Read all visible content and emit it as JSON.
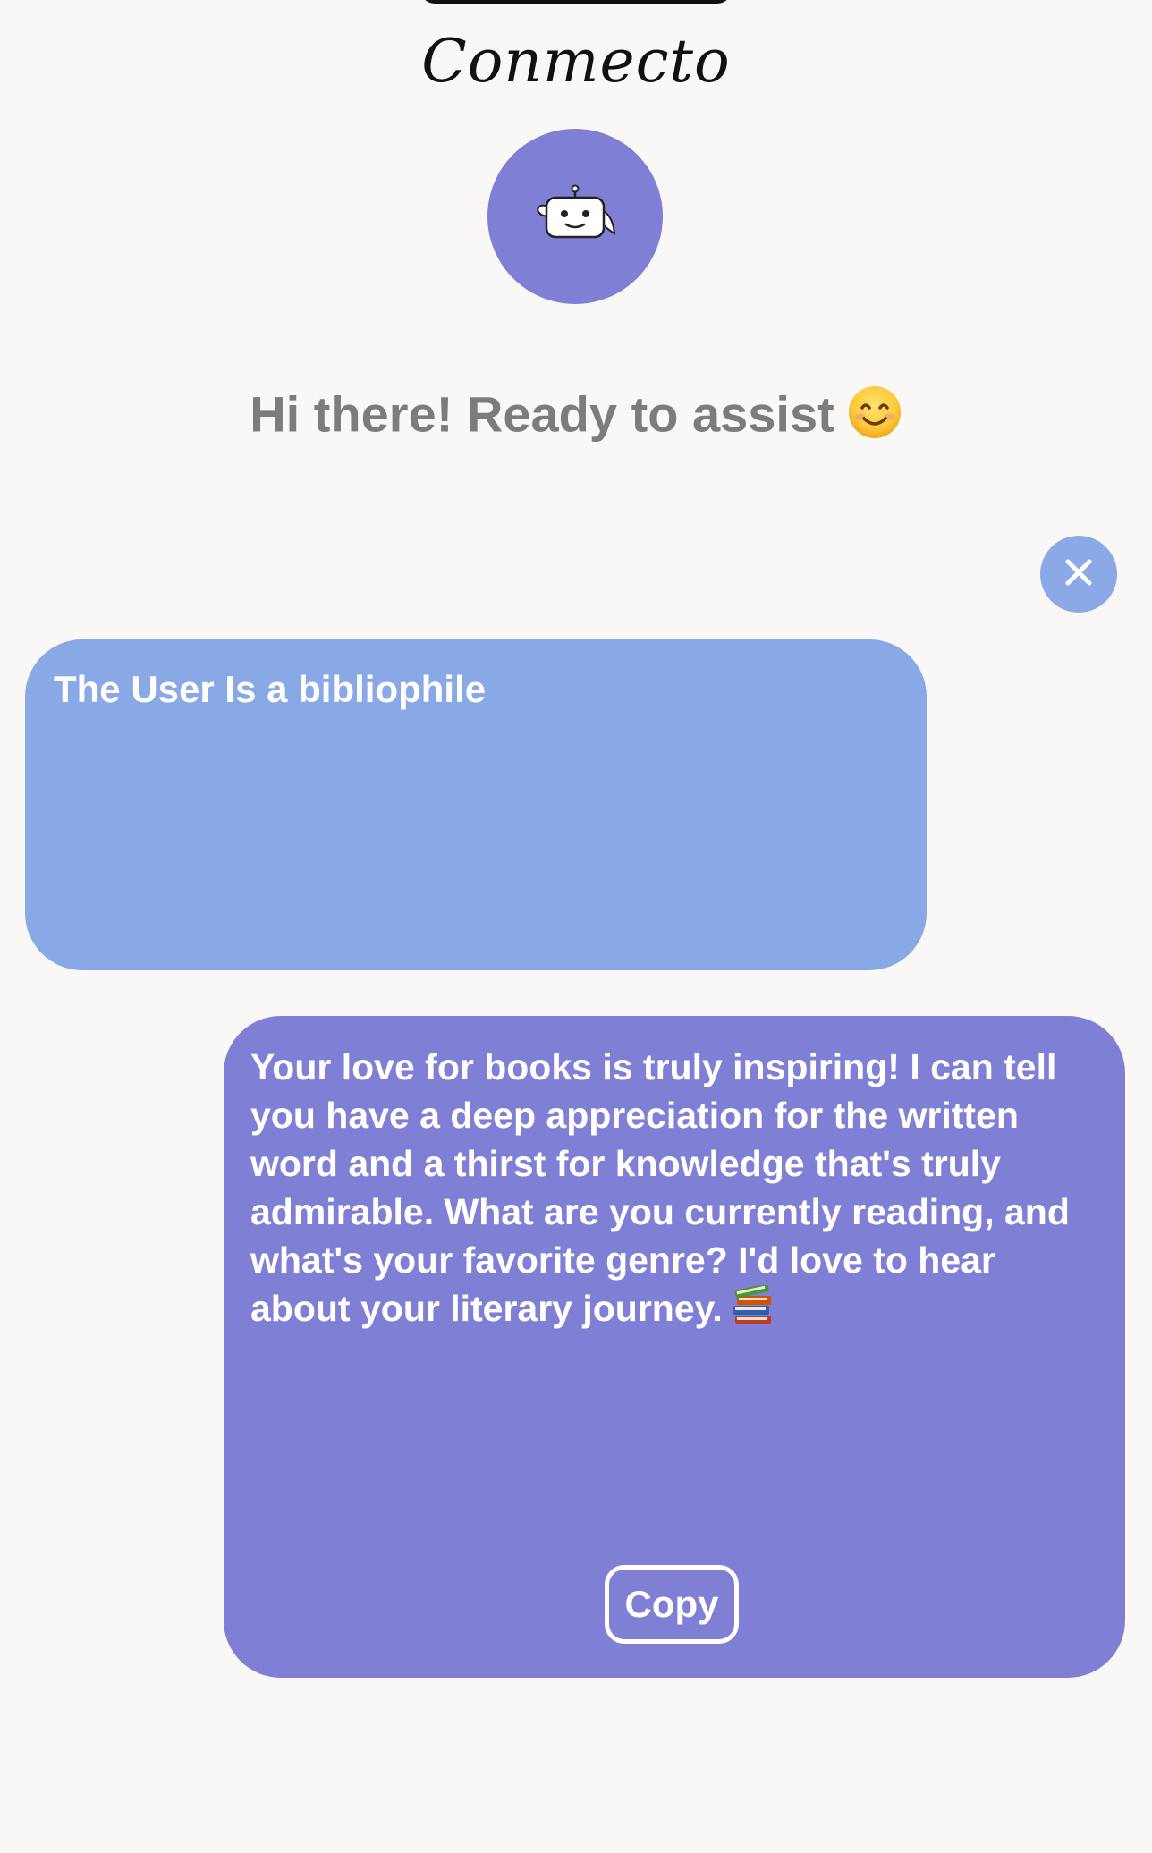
{
  "app": {
    "title": "Conmecto"
  },
  "header": {
    "greeting": "Hi there! Ready to assist",
    "greeting_emoji": "smiling-face-icon",
    "avatar_icon": "robot-icon"
  },
  "chat": {
    "close_icon": "close-icon",
    "user_message": "The User Is a bibliophile",
    "bot_message": "Your love for books is truly inspiring!  I can tell you have a deep appreciation for the written word and a thirst for knowledge that's truly admirable.  What are you currently reading, and what's your favorite genre?  I'd love to hear about your literary journey.",
    "bot_message_emoji": "books-icon",
    "copy_label": "Copy"
  },
  "colors": {
    "background": "#faf8f6",
    "accent_purple": "#7f80d5",
    "accent_blue": "#88a8e6",
    "greeting_gray": "#7c7c7c"
  }
}
